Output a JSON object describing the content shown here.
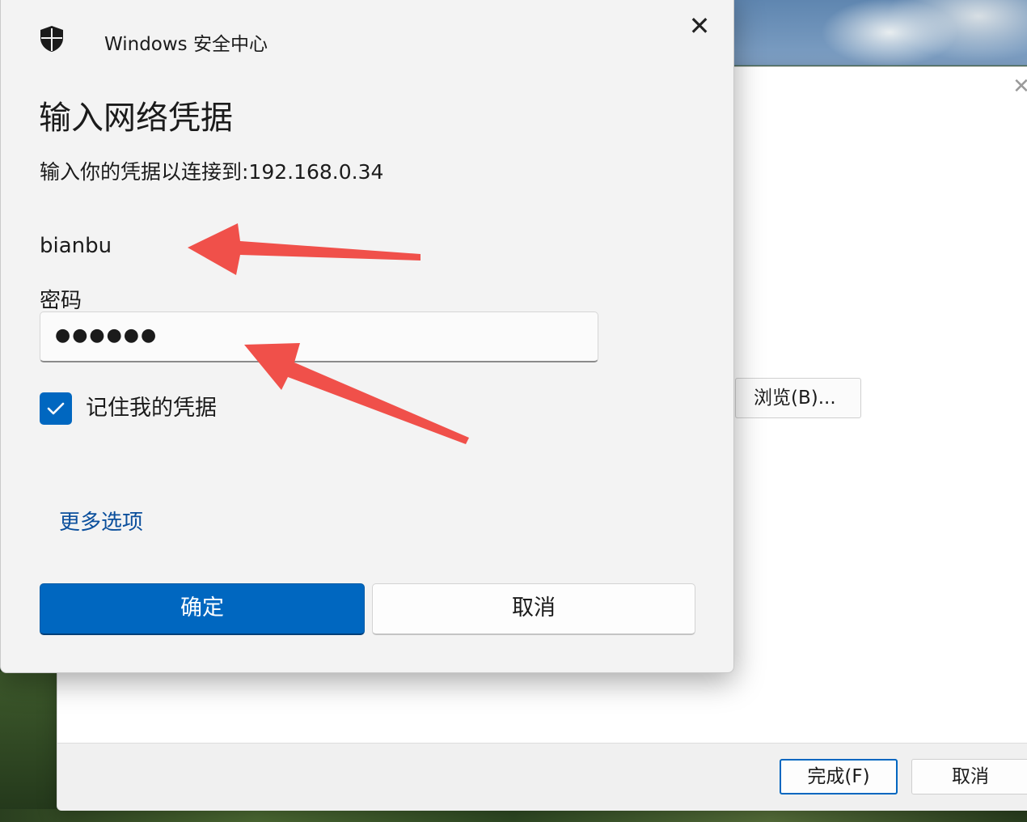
{
  "dialog": {
    "app_title": "Windows 安全中心",
    "heading": "输入网络凭据",
    "subtitle": "输入你的凭据以连接到:192.168.0.34",
    "username": "bianbu",
    "password_label": "密码",
    "password_value": "●●●●●●",
    "remember_label": "记住我的凭据",
    "remember_checked": true,
    "more_options": "更多选项",
    "ok_label": "确定",
    "cancel_label": "取消",
    "accent_color": "#0067c0"
  },
  "wizard": {
    "browse_label": "浏览(B)...",
    "finish_label": "完成(F)",
    "cancel_label": "取消"
  },
  "annotations": {
    "arrow_color": "#f0504a"
  }
}
